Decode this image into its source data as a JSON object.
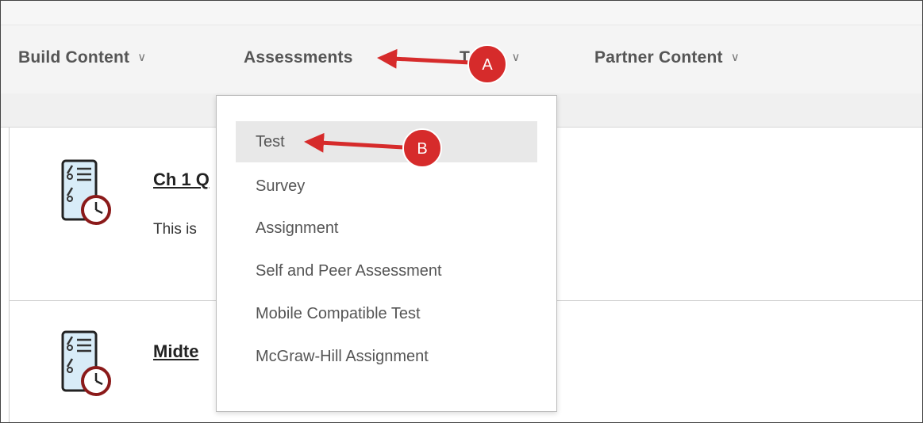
{
  "menu": {
    "items": [
      {
        "label": "Build Content",
        "chevron": "chevron-down-icon"
      },
      {
        "label": "Assessments",
        "chevron": ""
      },
      {
        "label": "Tools",
        "chevron": "chevron-down-icon"
      },
      {
        "label": "Partner Content",
        "chevron": "chevron-down-icon"
      }
    ]
  },
  "dropdown": {
    "items": [
      {
        "label": "Test",
        "highlighted": true
      },
      {
        "label": "Survey"
      },
      {
        "label": "Assignment"
      },
      {
        "label": "Self and Peer Assessment"
      },
      {
        "label": "Mobile Compatible Test"
      },
      {
        "label": "McGraw-Hill Assignment"
      }
    ]
  },
  "content": {
    "items": [
      {
        "title": "Ch 1 Q",
        "description": "This is",
        "icon": "test-icon"
      },
      {
        "title": "Midte",
        "icon": "test-icon"
      }
    ]
  },
  "annotations": {
    "a_label": "A",
    "b_label": "B",
    "color": "#d62b2b"
  }
}
